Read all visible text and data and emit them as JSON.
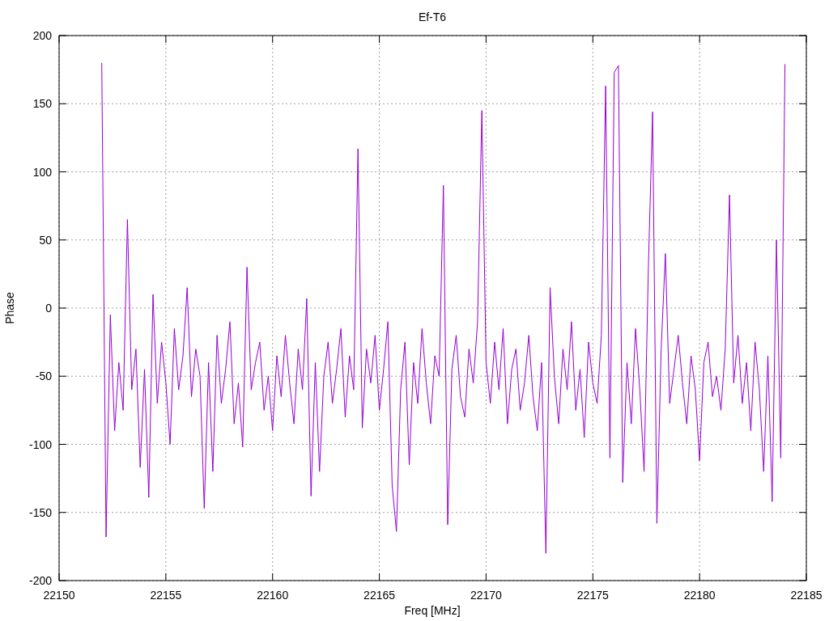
{
  "chart_data": {
    "type": "line",
    "title": "Ef-T6",
    "xlabel": "Freq [MHz]",
    "ylabel": "Phase",
    "xlim": [
      22150,
      22185
    ],
    "ylim": [
      -200,
      200
    ],
    "grid": true,
    "xticks": [
      22150,
      22155,
      22160,
      22165,
      22170,
      22175,
      22180,
      22185
    ],
    "yticks": [
      200,
      150,
      100,
      50,
      0,
      -50,
      -100,
      -150,
      -200
    ],
    "x": [
      22152,
      22152.2,
      22152.4,
      22152.6,
      22152.8,
      22153,
      22153.2,
      22153.4,
      22153.6,
      22153.8,
      22154,
      22154.2,
      22154.4,
      22154.6,
      22154.8,
      22155,
      22155.2,
      22155.4,
      22155.6,
      22155.8,
      22156,
      22156.2,
      22156.4,
      22156.6,
      22156.8,
      22157,
      22157.2,
      22157.4,
      22157.6,
      22157.8,
      22158,
      22158.2,
      22158.4,
      22158.6,
      22158.8,
      22159,
      22159.2,
      22159.4,
      22159.6,
      22159.8,
      22160,
      22160.2,
      22160.4,
      22160.6,
      22160.8,
      22161,
      22161.2,
      22161.4,
      22161.6,
      22161.8,
      22162,
      22162.2,
      22162.4,
      22162.6,
      22162.8,
      22163,
      22163.2,
      22163.4,
      22163.6,
      22163.8,
      22164,
      22164.2,
      22164.4,
      22164.6,
      22164.8,
      22165,
      22165.2,
      22165.4,
      22165.6,
      22165.8,
      22166,
      22166.2,
      22166.4,
      22166.6,
      22166.8,
      22167,
      22167.2,
      22167.4,
      22167.6,
      22167.8,
      22168,
      22168.2,
      22168.4,
      22168.6,
      22168.8,
      22169,
      22169.2,
      22169.4,
      22169.6,
      22169.8,
      22170,
      22170.2,
      22170.4,
      22170.6,
      22170.8,
      22171,
      22171.2,
      22171.4,
      22171.6,
      22171.8,
      22172,
      22172.2,
      22172.4,
      22172.6,
      22172.8,
      22173,
      22173.2,
      22173.4,
      22173.6,
      22173.8,
      22174,
      22174.2,
      22174.4,
      22174.6,
      22174.8,
      22175,
      22175.2,
      22175.4,
      22175.6,
      22175.8,
      22176,
      22176.2,
      22176.4,
      22176.6,
      22176.8,
      22177,
      22177.2,
      22177.4,
      22177.6,
      22177.8,
      22178,
      22178.2,
      22178.4,
      22178.6,
      22178.8,
      22179,
      22179.2,
      22179.4,
      22179.6,
      22179.8,
      22180,
      22180.2,
      22180.4,
      22180.6,
      22180.8,
      22181,
      22181.2,
      22181.4,
      22181.6,
      22181.8,
      22182,
      22182.2,
      22182.4,
      22182.6,
      22182.8,
      22183,
      22183.2,
      22183.4,
      22183.6,
      22183.8,
      22184
    ],
    "series": [
      {
        "color": "#9400d3",
        "values": [
          180,
          -168,
          -5,
          -90,
          -40,
          -75,
          65,
          -60,
          -30,
          -117,
          -45,
          -139,
          10,
          -70,
          -25,
          -55,
          -100,
          -15,
          -60,
          -35,
          15,
          -65,
          -30,
          -50,
          -147,
          -40,
          -120,
          -20,
          -70,
          -45,
          -10,
          -85,
          -55,
          -102,
          30,
          -60,
          -40,
          -25,
          -75,
          -50,
          -90,
          -35,
          -65,
          -20,
          -55,
          -85,
          -30,
          -60,
          7,
          -138,
          -40,
          -120,
          -50,
          -25,
          -70,
          -45,
          -15,
          -80,
          -35,
          -60,
          117,
          -88,
          -30,
          -55,
          -20,
          -75,
          -45,
          -10,
          -130,
          -164,
          -60,
          -25,
          -115,
          -40,
          -70,
          -15,
          -55,
          -85,
          -35,
          -50,
          90,
          -159,
          -45,
          -20,
          -65,
          -80,
          -30,
          -55,
          -10,
          145,
          -40,
          -70,
          -25,
          -60,
          -15,
          -85,
          -45,
          -30,
          -75,
          -55,
          -20,
          -65,
          -90,
          -40,
          -180,
          15,
          -50,
          -85,
          -30,
          -60,
          -10,
          -75,
          -45,
          -95,
          -25,
          -55,
          -70,
          -20,
          163,
          -110,
          173,
          178,
          -128,
          -40,
          -85,
          -15,
          -60,
          -120,
          30,
          144,
          -158,
          -30,
          40,
          -70,
          -45,
          -20,
          -55,
          -85,
          -35,
          -60,
          -112,
          -40,
          -25,
          -65,
          -50,
          -75,
          -30,
          83,
          -55,
          -20,
          -70,
          -40,
          -90,
          -25,
          -60,
          -120,
          -35,
          -142,
          50,
          -110,
          179
        ]
      }
    ]
  }
}
